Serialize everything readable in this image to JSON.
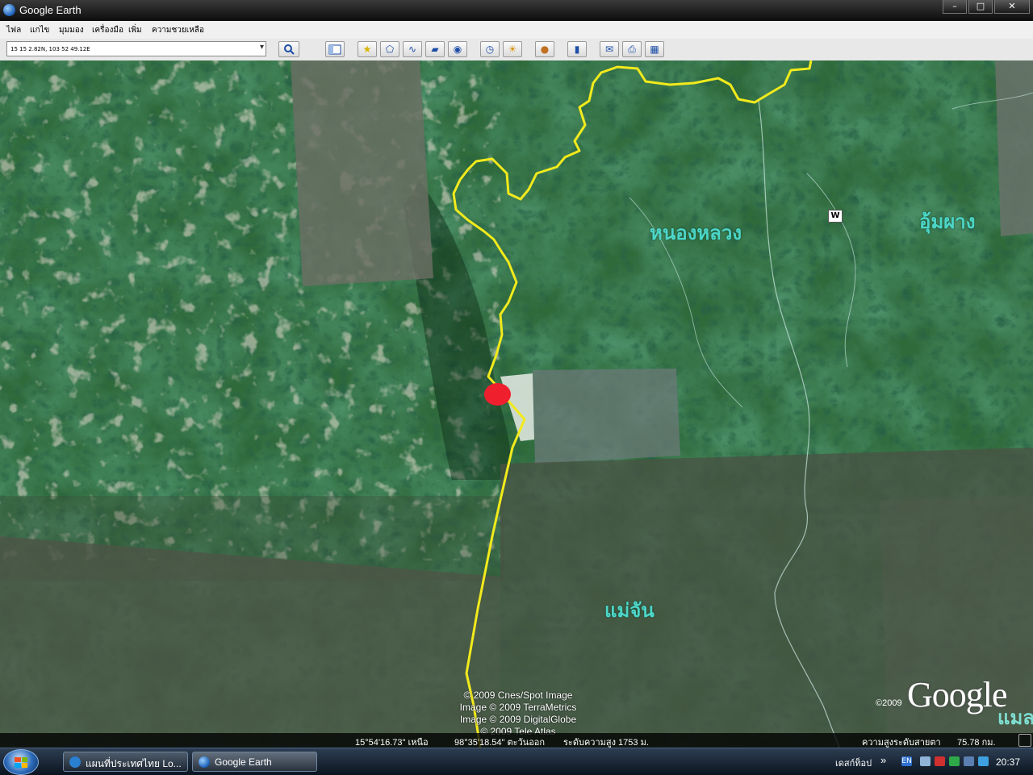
{
  "window": {
    "title": "Google Earth",
    "minimize": "–",
    "maximize": "□",
    "close": "✕"
  },
  "menu": [
    "ไฟล",
    "แกไข",
    "มุมมอง",
    "เครื่องมือ",
    "เพิ่ม",
    "ความชวยเหลือ"
  ],
  "search": {
    "value": "15 15 2.82N, 103 52 49.12E"
  },
  "map": {
    "labels": {
      "nonglong": "หนองหลวง",
      "umphang": "อุ้มผาง",
      "maechan": "แม่จัน"
    },
    "marker_w": "W",
    "credits": [
      "© 2009 Cnes/Spot Image",
      "Image © 2009 TerraMetrics",
      "Image © 2009 DigitalGlobe",
      "© 2009 Tele Atlas"
    ],
    "google_year": "©2009",
    "google_logo": "Google",
    "google_sub": "แมล"
  },
  "status": {
    "lat": "15°54'16.73\" เหนือ",
    "lon": "98°35'18.54\" ตะวันออก",
    "elev": "ระดับความสูง  1753 ม.",
    "eye_label": "ความสูงระดับสายตา",
    "eye_value": "75.78 กม."
  },
  "taskbar": {
    "tasks": [
      "แผนที่ประเทศไทย Lo...",
      "Google Earth"
    ],
    "desktop": "เดสก์ท็อป",
    "desktop_chev": "»",
    "lang": "EN",
    "time": "20:37"
  },
  "colors": {
    "border_line": "#f2ea1c",
    "marker": "#ef1f2e",
    "place_label": "#4dd6c8"
  }
}
